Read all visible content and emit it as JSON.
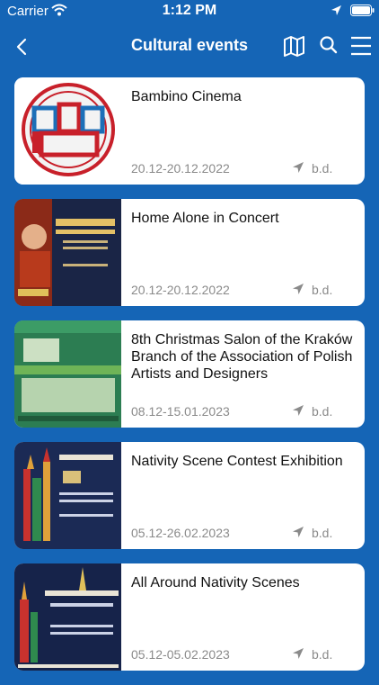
{
  "status": {
    "carrier": "Carrier",
    "time": "1:12 PM",
    "wifi_icon": "wifi-icon",
    "location_icon": "location-arrow-icon",
    "battery_icon": "battery-icon"
  },
  "nav": {
    "title": "Cultural events",
    "back_icon": "chevron-left-icon",
    "map_icon": "map-icon",
    "search_icon": "search-icon",
    "menu_icon": "hamburger-menu-icon"
  },
  "colors": {
    "background": "#1565b6",
    "card": "#ffffff",
    "meta_text": "#8a8a8a"
  },
  "events": [
    {
      "title": "Bambino Cinema",
      "dates": "20.12-20.12.2022",
      "location": "b.d."
    },
    {
      "title": "Home Alone in Concert",
      "dates": "20.12-20.12.2022",
      "location": "b.d."
    },
    {
      "title": "8th Christmas Salon of the Kraków Branch of the Association of Polish Artists and Designers",
      "dates": "08.12-15.01.2023",
      "location": "b.d."
    },
    {
      "title": "Nativity Scene Contest Exhibition",
      "dates": "05.12-26.02.2023",
      "location": "b.d."
    },
    {
      "title": "All Around Nativity Scenes",
      "dates": "05.12-05.02.2023",
      "location": "b.d."
    }
  ]
}
